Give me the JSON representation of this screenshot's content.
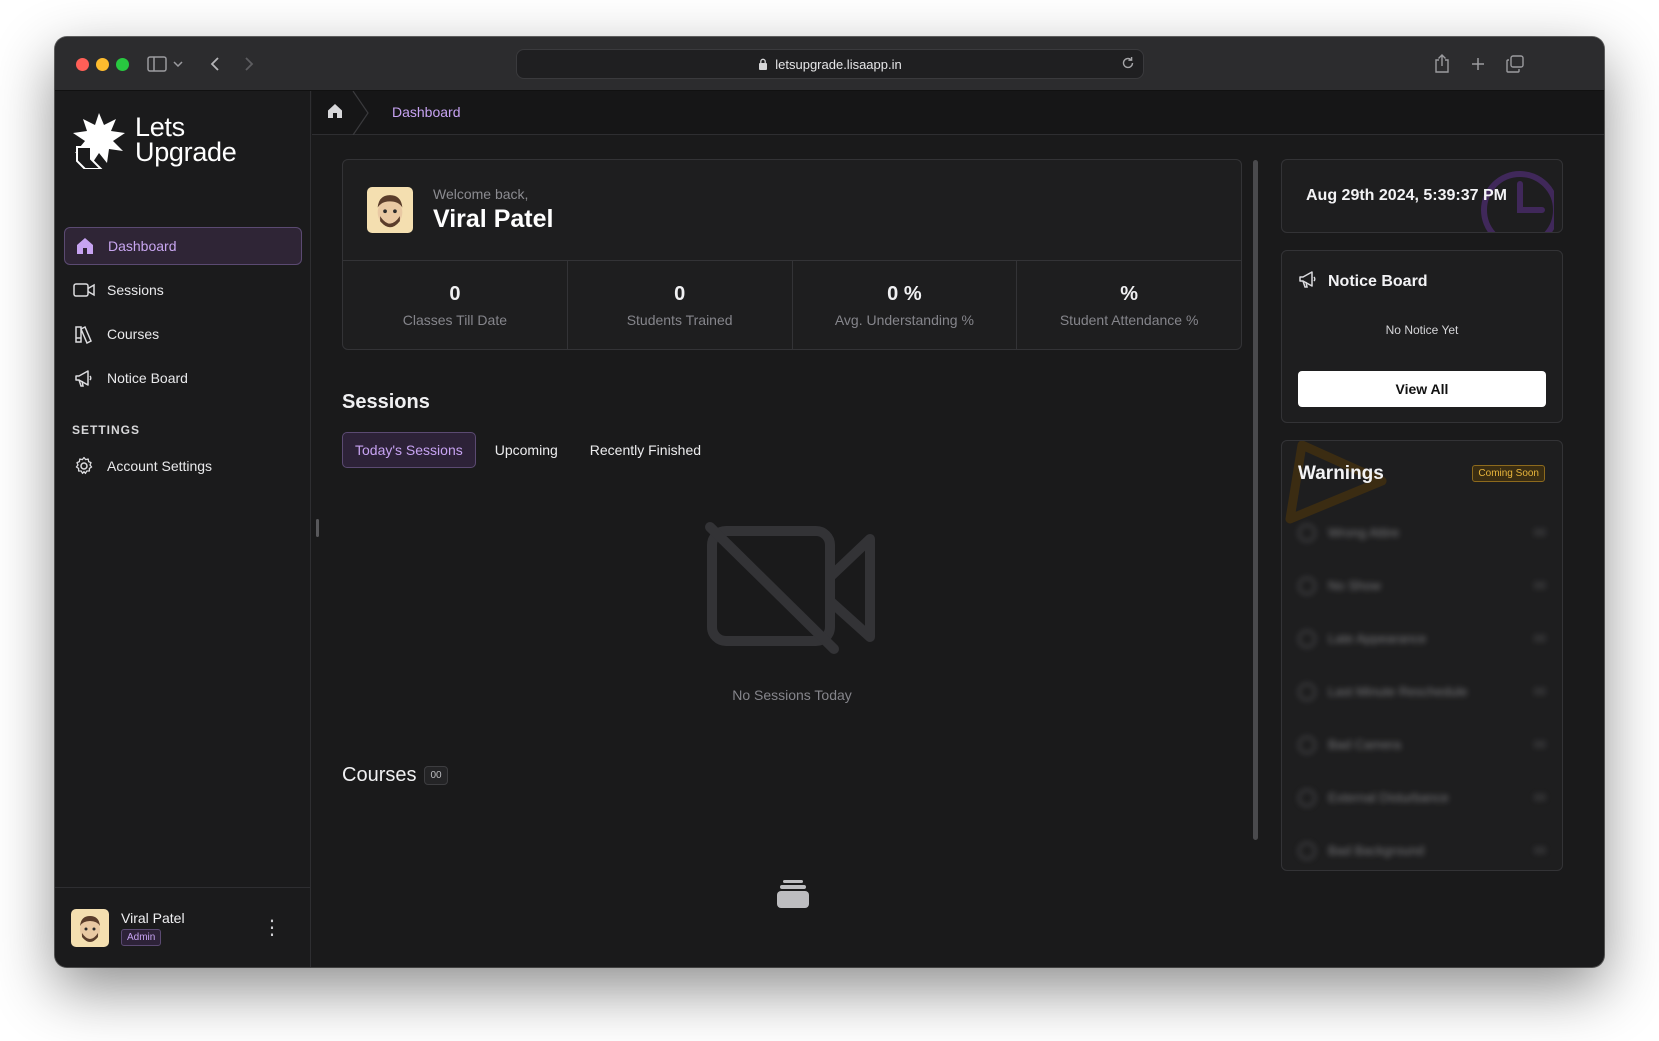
{
  "browser": {
    "url": "letsupgrade.lisaapp.in"
  },
  "brand": {
    "line1": "Lets",
    "line2": "Upgrade"
  },
  "sidebar": {
    "items": [
      {
        "label": "Dashboard",
        "icon": "home-icon",
        "active": true
      },
      {
        "label": "Sessions",
        "icon": "video-icon",
        "active": false
      },
      {
        "label": "Courses",
        "icon": "book-icon",
        "active": false
      },
      {
        "label": "Notice Board",
        "icon": "megaphone-icon",
        "active": false
      }
    ],
    "settings_heading": "SETTINGS",
    "account_settings": "Account Settings",
    "user": {
      "name": "Viral Patel",
      "role": "Admin"
    }
  },
  "breadcrumb": {
    "current": "Dashboard"
  },
  "welcome": {
    "greeting": "Welcome back,",
    "name": "Viral Patel"
  },
  "stats": [
    {
      "value": "0",
      "label": "Classes Till Date"
    },
    {
      "value": "0",
      "label": "Students Trained"
    },
    {
      "value": "0 %",
      "label": "Avg. Understanding %"
    },
    {
      "value": "%",
      "label": "Student Attendance %"
    }
  ],
  "sessions": {
    "title": "Sessions",
    "tabs": [
      "Today's Sessions",
      "Upcoming",
      "Recently Finished"
    ],
    "active_tab": "Today's Sessions",
    "empty_text": "No Sessions Today"
  },
  "courses": {
    "title": "Courses",
    "count": "00"
  },
  "clock": {
    "datetime": "Aug 29th 2024, 5:39:37 PM"
  },
  "notice_board": {
    "title": "Notice Board",
    "empty_text": "No Notice Yet",
    "button": "View All"
  },
  "warnings": {
    "title": "Warnings",
    "badge": "Coming Soon",
    "items": [
      {
        "label": "Wrong Attire",
        "count": "00"
      },
      {
        "label": "No Show",
        "count": "00"
      },
      {
        "label": "Late Appearance",
        "count": "00"
      },
      {
        "label": "Last Minute Reschedule",
        "count": "00"
      },
      {
        "label": "Bad Camera",
        "count": "00"
      },
      {
        "label": "External Disturbance",
        "count": "00"
      },
      {
        "label": "Bad Background",
        "count": "00"
      }
    ]
  },
  "colors": {
    "accent": "#c7a3f2",
    "background": "#1a1a1b",
    "warning": "#e8b53c"
  }
}
